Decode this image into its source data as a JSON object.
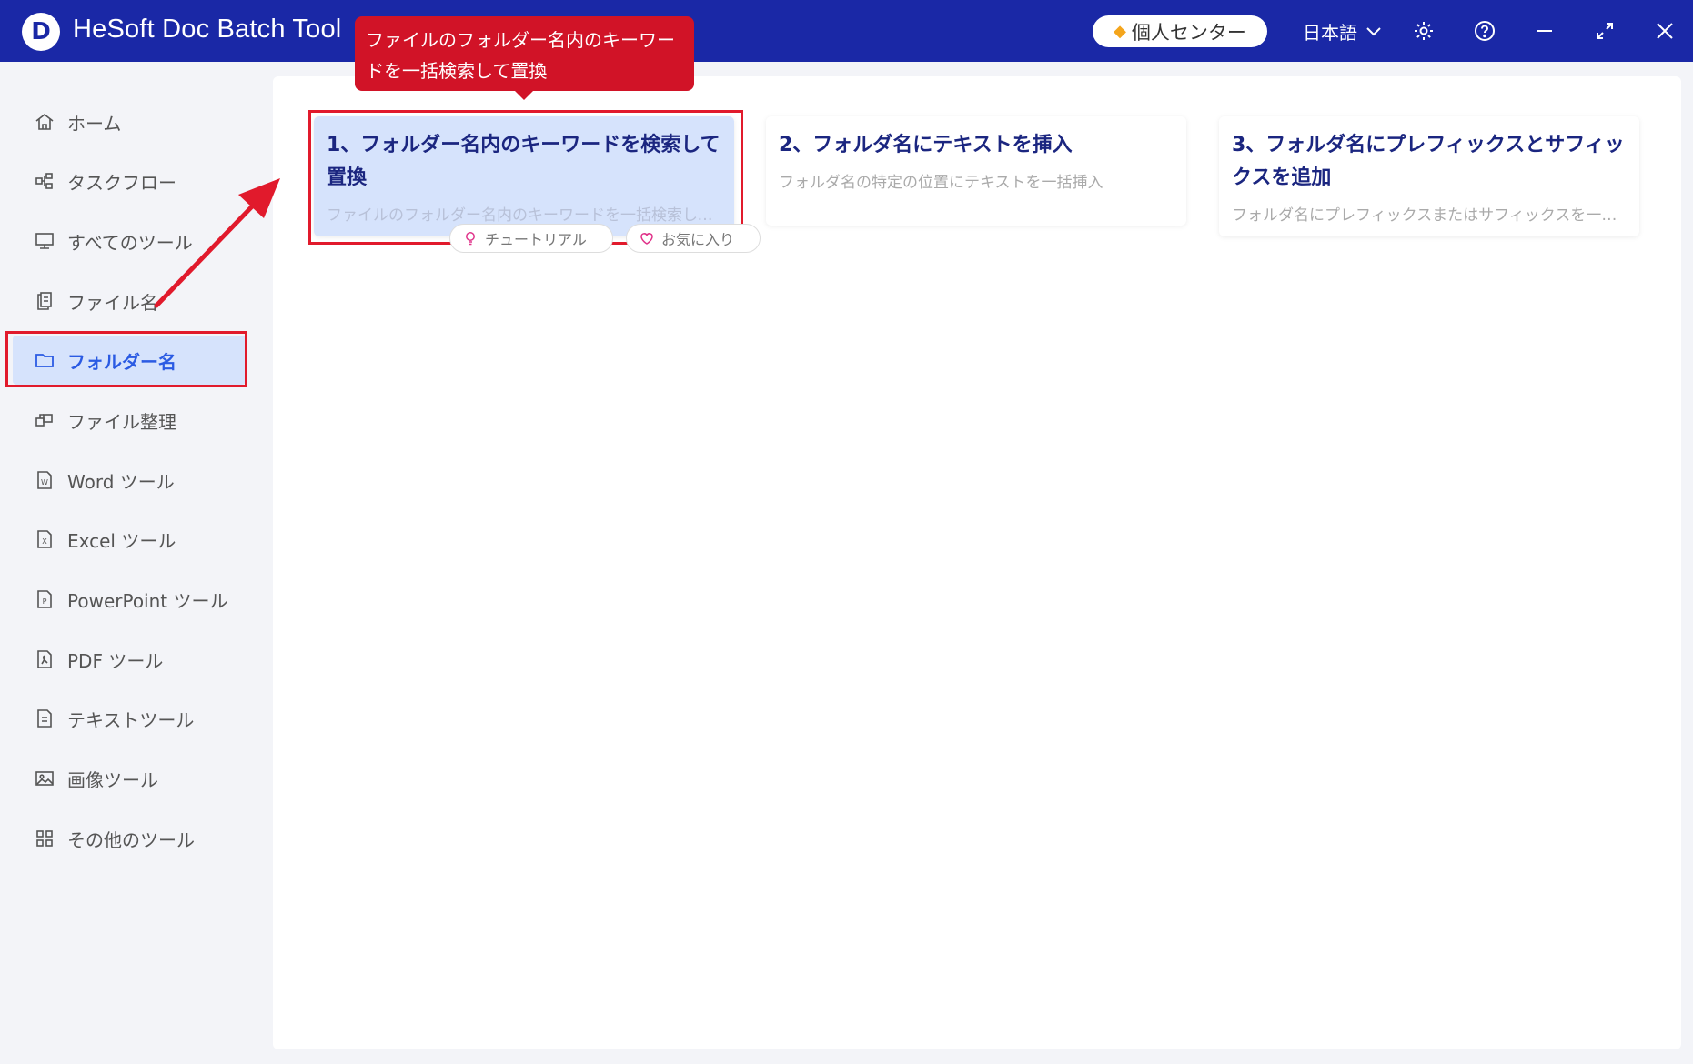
{
  "app": {
    "logo_letter": "D",
    "title": "HeSoft Doc Batch Tool"
  },
  "header": {
    "vip_label": "個人センター",
    "language": "日本語",
    "icons": [
      "settings-icon",
      "help-icon",
      "minimize-icon",
      "maximize-icon",
      "close-icon"
    ]
  },
  "tooltip": {
    "text": "ファイルのフォルダー名内のキーワードを一括検索して置換"
  },
  "sidebar": {
    "items": [
      {
        "label": "ホーム",
        "icon": "home-icon"
      },
      {
        "label": "タスクフロー",
        "icon": "taskflow-icon"
      },
      {
        "label": "すべてのツール",
        "icon": "monitor-icon"
      },
      {
        "label": "ファイル名",
        "icon": "file-copy-icon"
      },
      {
        "label": "フォルダー名",
        "icon": "folder-icon",
        "active": true
      },
      {
        "label": "ファイル整理",
        "icon": "organize-icon"
      },
      {
        "label": "Word ツール",
        "icon": "word-file-icon"
      },
      {
        "label": "Excel ツール",
        "icon": "excel-file-icon"
      },
      {
        "label": "PowerPoint ツール",
        "icon": "ppt-file-icon"
      },
      {
        "label": "PDF ツール",
        "icon": "pdf-file-icon"
      },
      {
        "label": "テキストツール",
        "icon": "text-file-icon"
      },
      {
        "label": "画像ツール",
        "icon": "image-icon"
      },
      {
        "label": "その他のツール",
        "icon": "grid-icon"
      }
    ]
  },
  "cards": [
    {
      "title": "1、フォルダー名内のキーワードを検索して置換",
      "desc": "ファイルのフォルダー名内のキーワードを一括検索して置換",
      "selected": true,
      "tutorial_label": "チュートリアル",
      "favorite_label": "お気に入り"
    },
    {
      "title": "2、フォルダ名にテキストを挿入",
      "desc": "フォルダ名の特定の位置にテキストを一括挿入"
    },
    {
      "title": "3、フォルダ名にプレフィックスとサフィックスを追加",
      "desc": "フォルダ名にプレフィックスまたはサフィックスを一括追加"
    }
  ],
  "colors": {
    "titlebar": "#1a28a6",
    "accent": "#2b5be3",
    "highlight": "#e11a2c",
    "selected_bg": "#d6e3fc"
  }
}
